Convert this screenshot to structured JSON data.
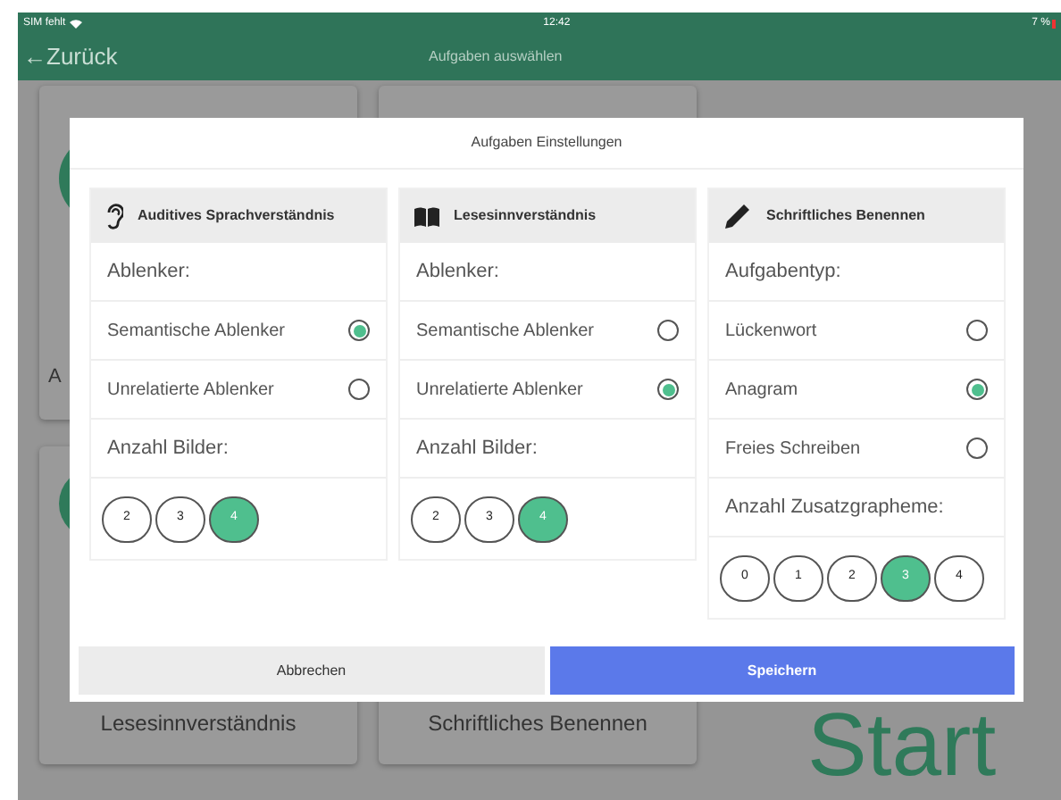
{
  "status_bar": {
    "carrier": "SIM fehlt",
    "time": "12:42",
    "battery": "7 %"
  },
  "nav_bar": {
    "back": "←Zurück",
    "title": "Aufgaben auswählen"
  },
  "background_cards": [
    {
      "label": "A"
    },
    {
      "label": "Lesesinnverständnis"
    },
    {
      "label": "Schriftliches Benennen"
    }
  ],
  "start_label": "Start",
  "dialog": {
    "title": "Aufgaben Einstellungen",
    "columns": [
      {
        "title": "Auditives Sprachverständnis",
        "rows": [
          {
            "kind": "heading",
            "label": "Ablenker:"
          },
          {
            "kind": "radio",
            "label": "Semantische Ablenker",
            "selected": true
          },
          {
            "kind": "radio",
            "label": "Unrelatierte Ablenker",
            "selected": false
          },
          {
            "kind": "heading",
            "label": "Anzahl Bilder:"
          },
          {
            "kind": "choices",
            "options": [
              {
                "label": "2",
                "selected": false
              },
              {
                "label": "3",
                "selected": false
              },
              {
                "label": "4",
                "selected": true
              }
            ]
          }
        ]
      },
      {
        "title": "Lesesinnverständnis",
        "rows": [
          {
            "kind": "heading",
            "label": "Ablenker:"
          },
          {
            "kind": "radio",
            "label": "Semantische Ablenker",
            "selected": false
          },
          {
            "kind": "radio",
            "label": "Unrelatierte Ablenker",
            "selected": true
          },
          {
            "kind": "heading",
            "label": "Anzahl Bilder:"
          },
          {
            "kind": "choices",
            "options": [
              {
                "label": "2",
                "selected": false
              },
              {
                "label": "3",
                "selected": false
              },
              {
                "label": "4",
                "selected": true
              }
            ]
          }
        ]
      },
      {
        "title": "Schriftliches Benennen",
        "rows": [
          {
            "kind": "heading",
            "label": "Aufgabentyp:"
          },
          {
            "kind": "radio",
            "label": "Lückenwort",
            "selected": false
          },
          {
            "kind": "radio",
            "label": "Anagram",
            "selected": true
          },
          {
            "kind": "radio",
            "label": "Freies Schreiben",
            "selected": false
          },
          {
            "kind": "heading",
            "label": "Anzahl Zusatzgrapheme:"
          },
          {
            "kind": "choices",
            "options": [
              {
                "label": "0",
                "selected": false
              },
              {
                "label": "1",
                "selected": false
              },
              {
                "label": "2",
                "selected": false
              },
              {
                "label": "3",
                "selected": true
              },
              {
                "label": "4",
                "selected": false
              }
            ]
          }
        ]
      }
    ],
    "buttons": [
      {
        "label": "Abbrechen",
        "kind": "secondary"
      },
      {
        "label": "Speichern",
        "kind": "primary"
      }
    ]
  }
}
